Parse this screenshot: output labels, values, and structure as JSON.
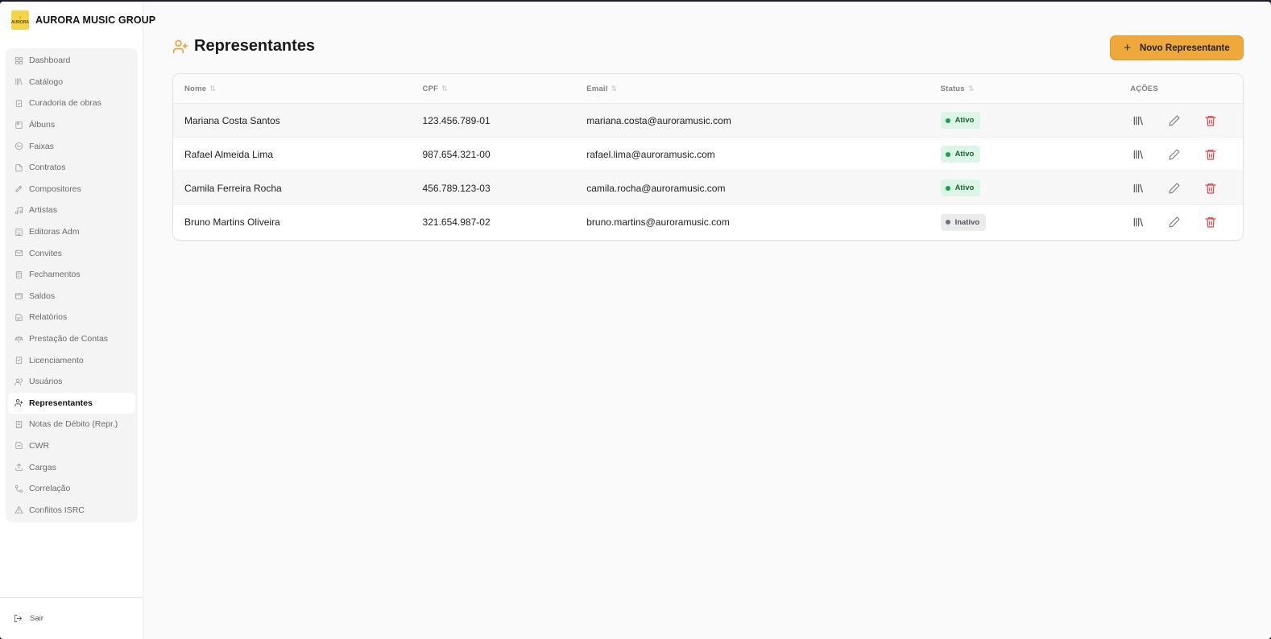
{
  "brand": {
    "name": "AURORA MUSIC GROUP",
    "logo_text": "AURORA"
  },
  "sidebar": {
    "items": [
      {
        "label": "Dashboard",
        "icon": "grid-icon"
      },
      {
        "label": "Catálogo",
        "icon": "library-icon"
      },
      {
        "label": "Curadoria de obras",
        "icon": "clipboard-check-icon"
      },
      {
        "label": "Álbuns",
        "icon": "album-icon"
      },
      {
        "label": "Faixas",
        "icon": "disc-icon"
      },
      {
        "label": "Contratos",
        "icon": "file-icon"
      },
      {
        "label": "Compositores",
        "icon": "pen-icon"
      },
      {
        "label": "Artistas",
        "icon": "music-note-icon"
      },
      {
        "label": "Editoras Adm",
        "icon": "building-icon"
      },
      {
        "label": "Convites",
        "icon": "mail-icon"
      },
      {
        "label": "Fechamentos",
        "icon": "calculator-icon"
      },
      {
        "label": "Saldos",
        "icon": "wallet-icon"
      },
      {
        "label": "Relatórios",
        "icon": "report-icon"
      },
      {
        "label": "Prestação de Contas",
        "icon": "scale-icon"
      },
      {
        "label": "Licenciamento",
        "icon": "license-icon"
      },
      {
        "label": "Usuários",
        "icon": "users-icon"
      },
      {
        "label": "Representantes",
        "icon": "user-plus-icon",
        "active": true
      },
      {
        "label": "Notas de Débito (Repr.)",
        "icon": "receipt-icon"
      },
      {
        "label": "CWR",
        "icon": "file-export-icon"
      },
      {
        "label": "Cargas",
        "icon": "upload-icon"
      },
      {
        "label": "Correlação",
        "icon": "link-icon"
      },
      {
        "label": "Conflitos ISRC",
        "icon": "warning-icon"
      }
    ],
    "logout_label": "Sair"
  },
  "page": {
    "title": "Representantes",
    "new_button": "Novo Representante"
  },
  "table": {
    "headers": {
      "name": "Nome",
      "cpf": "CPF",
      "email": "Email",
      "status": "Status",
      "actions": "AÇÕES"
    },
    "rows": [
      {
        "name": "Mariana Costa Santos",
        "cpf": "123.456.789-01",
        "email": "mariana.costa@auroramusic.com",
        "status": "Ativo",
        "active": true
      },
      {
        "name": "Rafael Almeida Lima",
        "cpf": "987.654.321-00",
        "email": "rafael.lima@auroramusic.com",
        "status": "Ativo",
        "active": true
      },
      {
        "name": "Camila Ferreira Rocha",
        "cpf": "456.789.123-03",
        "email": "camila.rocha@auroramusic.com",
        "status": "Ativo",
        "active": true
      },
      {
        "name": "Bruno Martins Oliveira",
        "cpf": "321.654.987-02",
        "email": "bruno.martins@auroramusic.com",
        "status": "Inativo",
        "active": false
      }
    ]
  },
  "colors": {
    "accent": "#efa93a",
    "active_badge": "#dcf5e6",
    "inactive_badge": "#ebebeb",
    "danger": "#e04545"
  }
}
